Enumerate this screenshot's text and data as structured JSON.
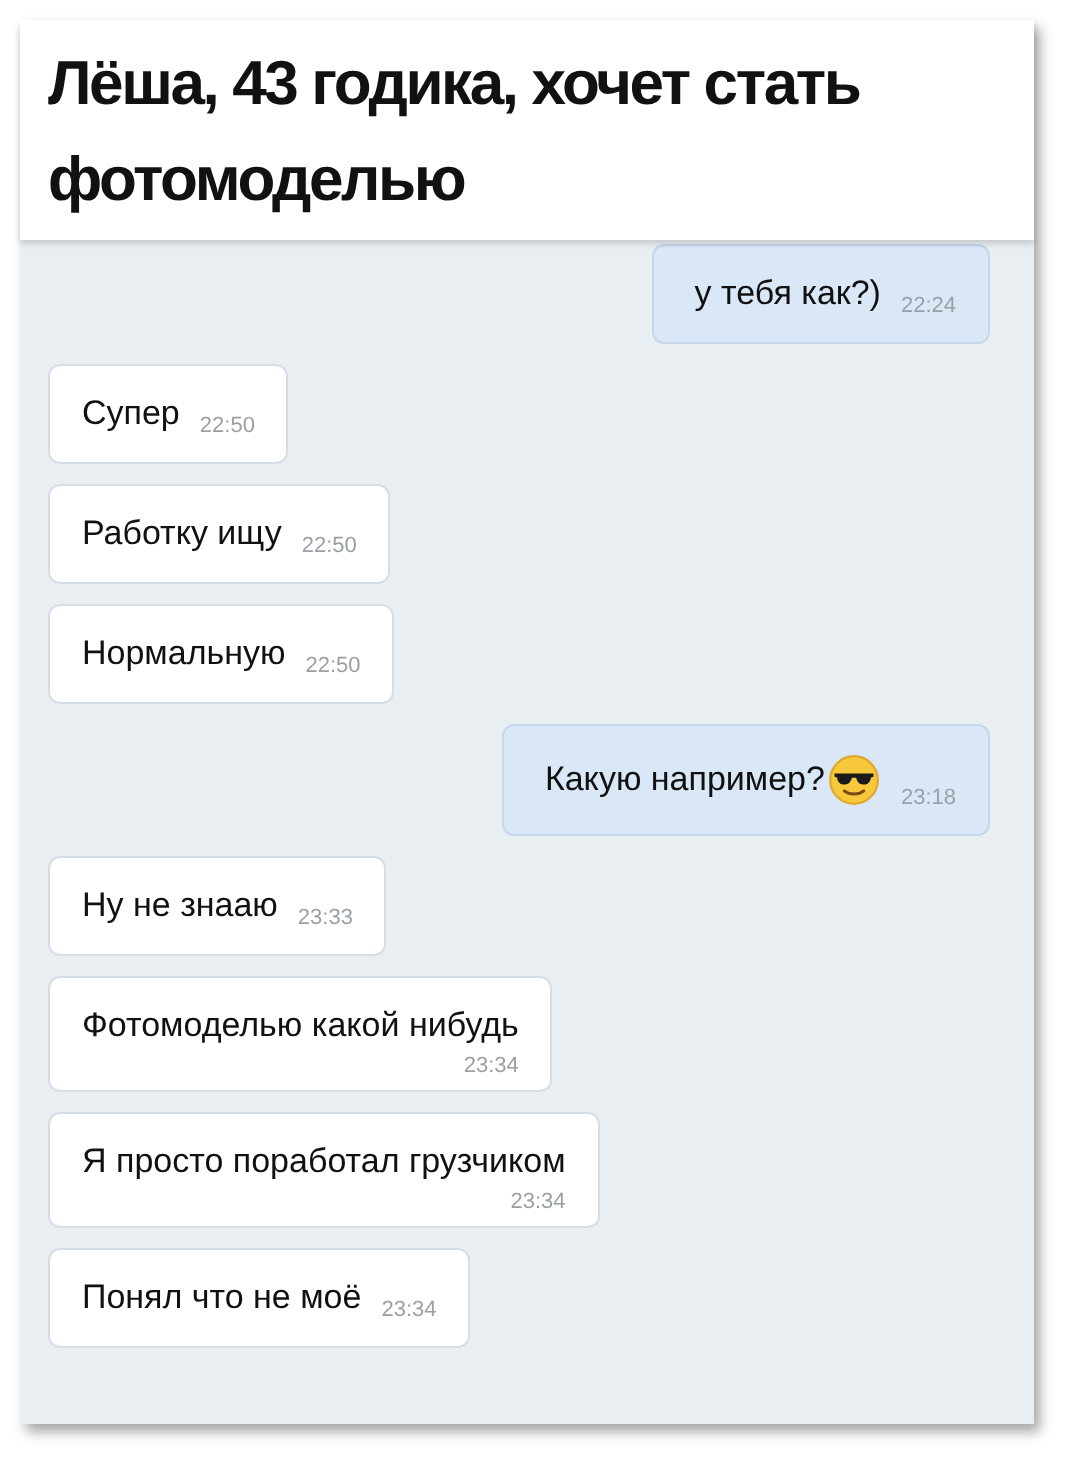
{
  "caption": "Лёша, 43 годика, хочет стать фотомоделью",
  "messages": [
    {
      "kind": "outgoing",
      "text": "у тебя как?)",
      "time": "22:24",
      "emoji": false,
      "time_below": false
    },
    {
      "kind": "incoming",
      "text": "Супер",
      "time": "22:50",
      "emoji": false,
      "time_below": false
    },
    {
      "kind": "incoming",
      "text": "Работку ищу",
      "time": "22:50",
      "emoji": false,
      "time_below": false
    },
    {
      "kind": "incoming",
      "text": "Нормальную",
      "time": "22:50",
      "emoji": false,
      "time_below": false
    },
    {
      "kind": "outgoing",
      "text": "Какую например?",
      "time": "23:18",
      "emoji": true,
      "time_below": false
    },
    {
      "kind": "incoming",
      "text": "Ну не знааю",
      "time": "23:33",
      "emoji": false,
      "time_below": false
    },
    {
      "kind": "incoming",
      "text": "Фотомоделью какой нибудь",
      "time": "23:34",
      "emoji": false,
      "time_below": true
    },
    {
      "kind": "incoming",
      "text": "Я просто поработал грузчиком",
      "time": "23:34",
      "emoji": false,
      "time_below": true
    },
    {
      "kind": "incoming",
      "text": "Понял что не моё",
      "time": "23:34",
      "emoji": false,
      "time_below": false
    }
  ]
}
